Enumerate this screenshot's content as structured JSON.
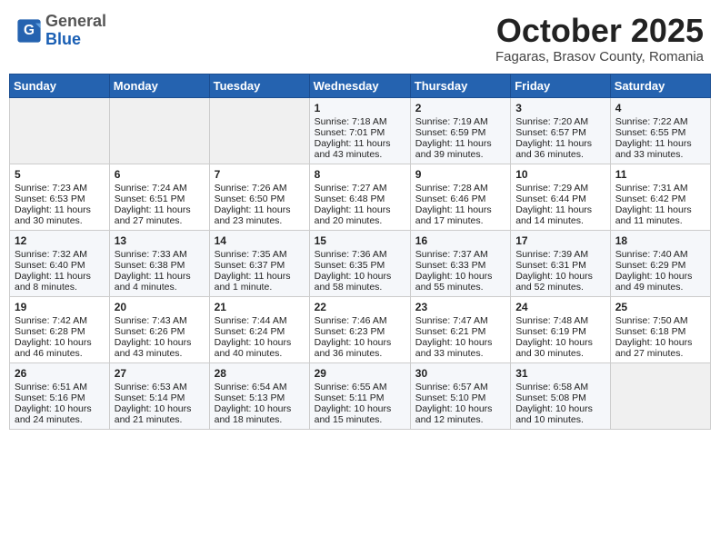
{
  "logo": {
    "general": "General",
    "blue": "Blue"
  },
  "title": "October 2025",
  "location": "Fagaras, Brasov County, Romania",
  "headers": [
    "Sunday",
    "Monday",
    "Tuesday",
    "Wednesday",
    "Thursday",
    "Friday",
    "Saturday"
  ],
  "weeks": [
    [
      {
        "num": "",
        "lines": []
      },
      {
        "num": "",
        "lines": []
      },
      {
        "num": "",
        "lines": []
      },
      {
        "num": "1",
        "lines": [
          "Sunrise: 7:18 AM",
          "Sunset: 7:01 PM",
          "Daylight: 11 hours",
          "and 43 minutes."
        ]
      },
      {
        "num": "2",
        "lines": [
          "Sunrise: 7:19 AM",
          "Sunset: 6:59 PM",
          "Daylight: 11 hours",
          "and 39 minutes."
        ]
      },
      {
        "num": "3",
        "lines": [
          "Sunrise: 7:20 AM",
          "Sunset: 6:57 PM",
          "Daylight: 11 hours",
          "and 36 minutes."
        ]
      },
      {
        "num": "4",
        "lines": [
          "Sunrise: 7:22 AM",
          "Sunset: 6:55 PM",
          "Daylight: 11 hours",
          "and 33 minutes."
        ]
      }
    ],
    [
      {
        "num": "5",
        "lines": [
          "Sunrise: 7:23 AM",
          "Sunset: 6:53 PM",
          "Daylight: 11 hours",
          "and 30 minutes."
        ]
      },
      {
        "num": "6",
        "lines": [
          "Sunrise: 7:24 AM",
          "Sunset: 6:51 PM",
          "Daylight: 11 hours",
          "and 27 minutes."
        ]
      },
      {
        "num": "7",
        "lines": [
          "Sunrise: 7:26 AM",
          "Sunset: 6:50 PM",
          "Daylight: 11 hours",
          "and 23 minutes."
        ]
      },
      {
        "num": "8",
        "lines": [
          "Sunrise: 7:27 AM",
          "Sunset: 6:48 PM",
          "Daylight: 11 hours",
          "and 20 minutes."
        ]
      },
      {
        "num": "9",
        "lines": [
          "Sunrise: 7:28 AM",
          "Sunset: 6:46 PM",
          "Daylight: 11 hours",
          "and 17 minutes."
        ]
      },
      {
        "num": "10",
        "lines": [
          "Sunrise: 7:29 AM",
          "Sunset: 6:44 PM",
          "Daylight: 11 hours",
          "and 14 minutes."
        ]
      },
      {
        "num": "11",
        "lines": [
          "Sunrise: 7:31 AM",
          "Sunset: 6:42 PM",
          "Daylight: 11 hours",
          "and 11 minutes."
        ]
      }
    ],
    [
      {
        "num": "12",
        "lines": [
          "Sunrise: 7:32 AM",
          "Sunset: 6:40 PM",
          "Daylight: 11 hours",
          "and 8 minutes."
        ]
      },
      {
        "num": "13",
        "lines": [
          "Sunrise: 7:33 AM",
          "Sunset: 6:38 PM",
          "Daylight: 11 hours",
          "and 4 minutes."
        ]
      },
      {
        "num": "14",
        "lines": [
          "Sunrise: 7:35 AM",
          "Sunset: 6:37 PM",
          "Daylight: 11 hours",
          "and 1 minute."
        ]
      },
      {
        "num": "15",
        "lines": [
          "Sunrise: 7:36 AM",
          "Sunset: 6:35 PM",
          "Daylight: 10 hours",
          "and 58 minutes."
        ]
      },
      {
        "num": "16",
        "lines": [
          "Sunrise: 7:37 AM",
          "Sunset: 6:33 PM",
          "Daylight: 10 hours",
          "and 55 minutes."
        ]
      },
      {
        "num": "17",
        "lines": [
          "Sunrise: 7:39 AM",
          "Sunset: 6:31 PM",
          "Daylight: 10 hours",
          "and 52 minutes."
        ]
      },
      {
        "num": "18",
        "lines": [
          "Sunrise: 7:40 AM",
          "Sunset: 6:29 PM",
          "Daylight: 10 hours",
          "and 49 minutes."
        ]
      }
    ],
    [
      {
        "num": "19",
        "lines": [
          "Sunrise: 7:42 AM",
          "Sunset: 6:28 PM",
          "Daylight: 10 hours",
          "and 46 minutes."
        ]
      },
      {
        "num": "20",
        "lines": [
          "Sunrise: 7:43 AM",
          "Sunset: 6:26 PM",
          "Daylight: 10 hours",
          "and 43 minutes."
        ]
      },
      {
        "num": "21",
        "lines": [
          "Sunrise: 7:44 AM",
          "Sunset: 6:24 PM",
          "Daylight: 10 hours",
          "and 40 minutes."
        ]
      },
      {
        "num": "22",
        "lines": [
          "Sunrise: 7:46 AM",
          "Sunset: 6:23 PM",
          "Daylight: 10 hours",
          "and 36 minutes."
        ]
      },
      {
        "num": "23",
        "lines": [
          "Sunrise: 7:47 AM",
          "Sunset: 6:21 PM",
          "Daylight: 10 hours",
          "and 33 minutes."
        ]
      },
      {
        "num": "24",
        "lines": [
          "Sunrise: 7:48 AM",
          "Sunset: 6:19 PM",
          "Daylight: 10 hours",
          "and 30 minutes."
        ]
      },
      {
        "num": "25",
        "lines": [
          "Sunrise: 7:50 AM",
          "Sunset: 6:18 PM",
          "Daylight: 10 hours",
          "and 27 minutes."
        ]
      }
    ],
    [
      {
        "num": "26",
        "lines": [
          "Sunrise: 6:51 AM",
          "Sunset: 5:16 PM",
          "Daylight: 10 hours",
          "and 24 minutes."
        ]
      },
      {
        "num": "27",
        "lines": [
          "Sunrise: 6:53 AM",
          "Sunset: 5:14 PM",
          "Daylight: 10 hours",
          "and 21 minutes."
        ]
      },
      {
        "num": "28",
        "lines": [
          "Sunrise: 6:54 AM",
          "Sunset: 5:13 PM",
          "Daylight: 10 hours",
          "and 18 minutes."
        ]
      },
      {
        "num": "29",
        "lines": [
          "Sunrise: 6:55 AM",
          "Sunset: 5:11 PM",
          "Daylight: 10 hours",
          "and 15 minutes."
        ]
      },
      {
        "num": "30",
        "lines": [
          "Sunrise: 6:57 AM",
          "Sunset: 5:10 PM",
          "Daylight: 10 hours",
          "and 12 minutes."
        ]
      },
      {
        "num": "31",
        "lines": [
          "Sunrise: 6:58 AM",
          "Sunset: 5:08 PM",
          "Daylight: 10 hours",
          "and 10 minutes."
        ]
      },
      {
        "num": "",
        "lines": []
      }
    ]
  ]
}
